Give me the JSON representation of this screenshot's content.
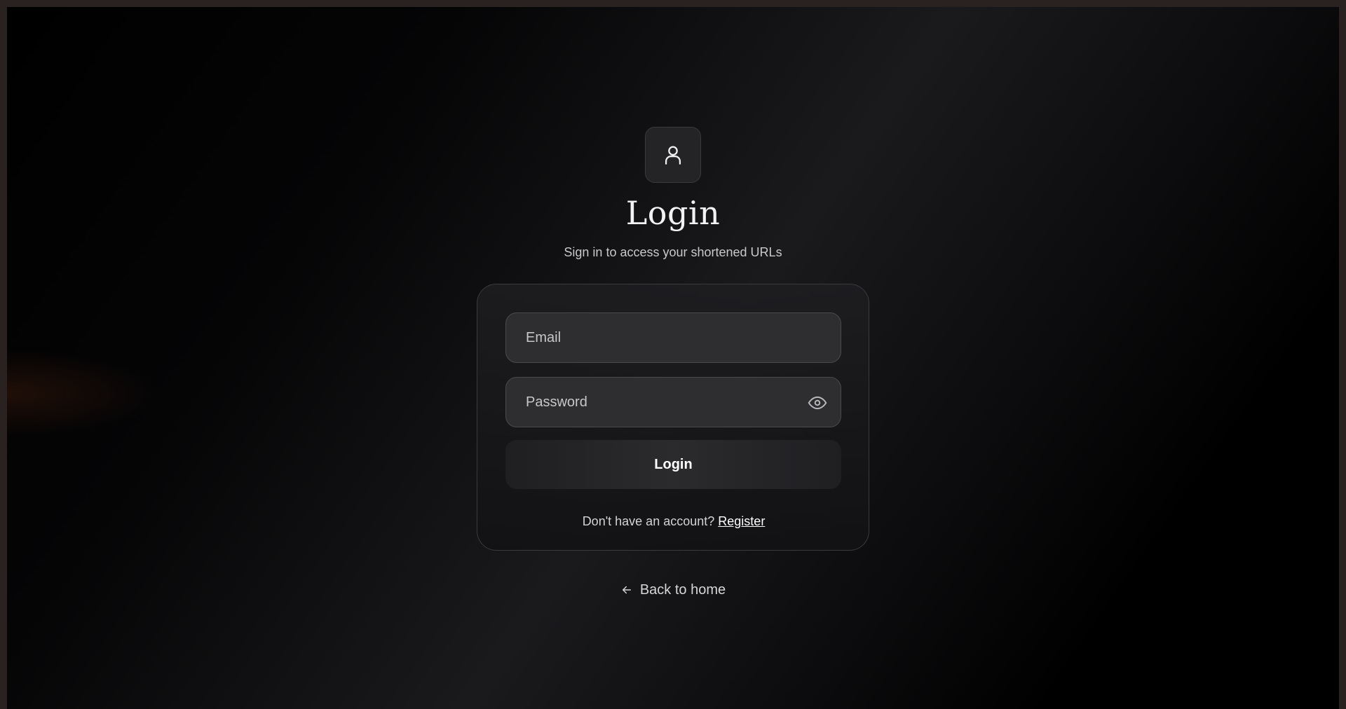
{
  "header": {
    "icon": "user-icon",
    "title": "Login",
    "subtitle": "Sign in to access your shortened URLs"
  },
  "form": {
    "email": {
      "placeholder": "Email",
      "value": ""
    },
    "password": {
      "placeholder": "Password",
      "value": "",
      "toggle_icon": "eye-icon"
    },
    "submit_label": "Login",
    "register_prompt": "Don't have an account?",
    "register_link": "Register"
  },
  "footer": {
    "back_icon": "arrow-left-icon",
    "back_label": "Back to home"
  },
  "colors": {
    "background": "#000000",
    "card_border": "#3b3b3f",
    "input_background": "#2e2e31",
    "text": "#f2f2f2"
  }
}
